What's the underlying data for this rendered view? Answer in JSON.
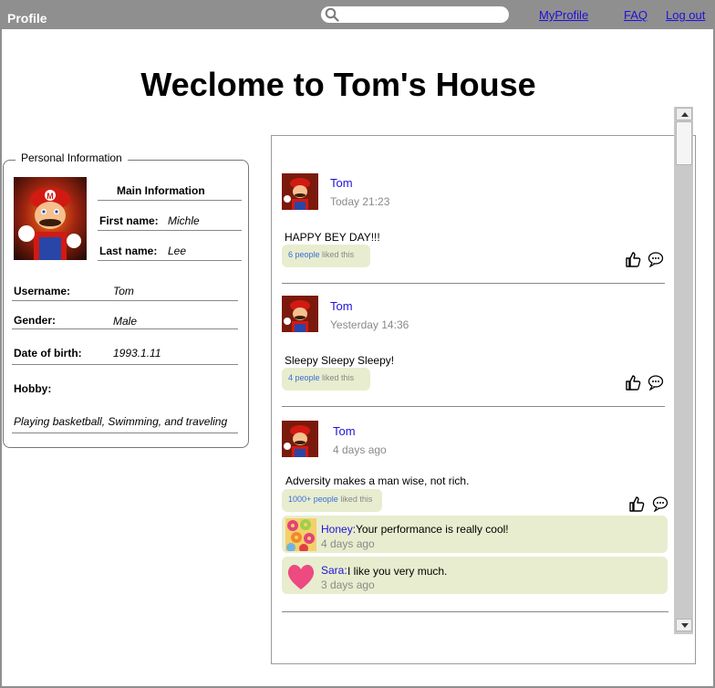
{
  "topbar": {
    "title": "Profile",
    "search_value": "",
    "links": {
      "my_profile": "MyProfile",
      "faq": "FAQ",
      "logout": "Log out"
    }
  },
  "page": {
    "welcome": "Weclome to Tom's House"
  },
  "personal_info": {
    "legend": "Personal Information",
    "main_heading": "Main Information",
    "first_name_label": "First name:",
    "first_name": "Michle",
    "last_name_label": "Last name:",
    "last_name": "Lee",
    "username_label": "Username:",
    "username": "Tom",
    "gender_label": "Gender:",
    "gender": "Male",
    "dob_label": "Date of birth:",
    "dob": "1993.1.11",
    "hobby_label": "Hobby:",
    "hobby": "Playing basketball, Swimming, and traveling"
  },
  "feed": {
    "posts": [
      {
        "author": "Tom",
        "time": "Today 21:23",
        "text": "HAPPY BEY DAY!!!",
        "likes_count": "6 people",
        "likes_suffix": " liked this"
      },
      {
        "author": "Tom",
        "time": "Yesterday 14:36",
        "text": "Sleepy Sleepy Sleepy!",
        "likes_count": "4 people",
        "likes_suffix": " liked this"
      },
      {
        "author": "Tom",
        "time": "4 days ago",
        "text": "Adversity makes a man wise, not rich.",
        "likes_count": "1000+ people",
        "likes_suffix": " liked this",
        "comments": [
          {
            "author": "Honey:",
            "text": " Your performance is really cool!",
            "time": "4 days ago"
          },
          {
            "author": "Sara:",
            "text": " I like you very much.",
            "time": "3 days ago"
          }
        ]
      }
    ]
  },
  "colors": {
    "topbar": "#8f8f8f",
    "link": "#1f12d8",
    "comment_bg": "#e8edcf",
    "likes_blue": "#3b6ed6"
  },
  "icons": [
    "search-icon",
    "thumbs-up-icon",
    "comment-icon",
    "heart-icon",
    "avatar-mario",
    "avatar-donuts"
  ]
}
